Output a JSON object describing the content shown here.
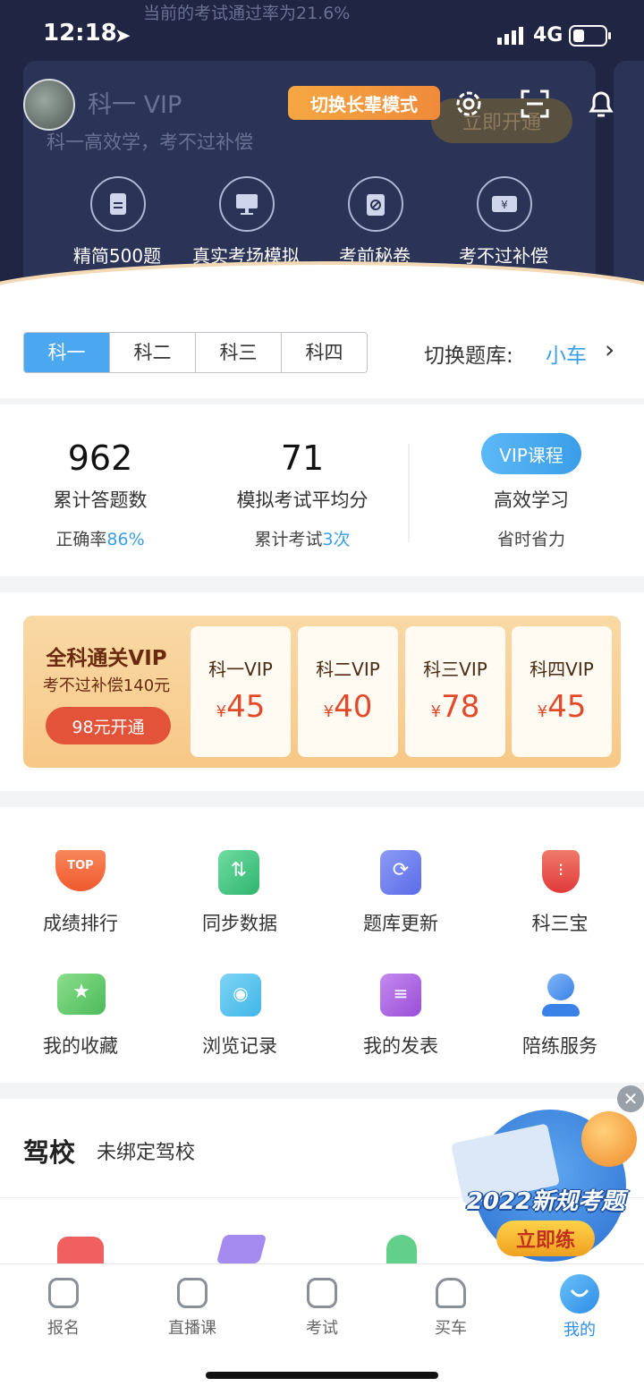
{
  "status_bar": {
    "time": "12:18",
    "network": "4G"
  },
  "hero": {
    "top_notice": "当前的考试通过率为21.6%",
    "title": "科一 VIP",
    "subtitle": "科一高效学，考不过补偿",
    "open_button": "立即开通",
    "elder_mode_button": "切换长辈模式",
    "features": [
      {
        "icon": "document-icon",
        "label": "精简500题"
      },
      {
        "icon": "monitor-icon",
        "label": "真实考场模拟"
      },
      {
        "icon": "clipboard-icon",
        "label": "考前秘卷"
      },
      {
        "icon": "ticket-icon",
        "label": "考不过补偿"
      }
    ]
  },
  "subjects": {
    "tabs": [
      "科一",
      "科二",
      "科三",
      "科四"
    ],
    "active": 0,
    "switch_label": "切换题库:",
    "switch_value": "小车"
  },
  "stats": {
    "answered": {
      "value": "962",
      "label": "累计答题数",
      "sub_label": "正确率",
      "sub_value": "86%"
    },
    "mock": {
      "value": "71",
      "label": "模拟考试平均分",
      "sub_label": "累计考试",
      "sub_value": "3次"
    },
    "vip_course": {
      "badge": "VIP课程",
      "line1": "高效学习",
      "line2": "省时省力"
    }
  },
  "vip_banner": {
    "title": "全科通关VIP",
    "subtitle": "考不过补偿140元",
    "button": "98元开通",
    "currency": "¥",
    "cards": [
      {
        "title": "科一VIP",
        "price": "45"
      },
      {
        "title": "科二VIP",
        "price": "40"
      },
      {
        "title": "科三VIP",
        "price": "78"
      },
      {
        "title": "科四VIP",
        "price": "45"
      }
    ]
  },
  "tools": [
    {
      "icon": "trophy-icon",
      "label": "成绩排行",
      "color": "#f26a3d"
    },
    {
      "icon": "sync-icon",
      "label": "同步数据",
      "color": "#3fc37f"
    },
    {
      "icon": "refresh-doc-icon",
      "label": "题库更新",
      "color": "#6b7cf0"
    },
    {
      "icon": "shield-icon",
      "label": "科三宝",
      "color": "#e84a4a"
    },
    {
      "icon": "star-folder-icon",
      "label": "我的收藏",
      "color": "#5bc868"
    },
    {
      "icon": "history-icon",
      "label": "浏览记录",
      "color": "#3fb6e8"
    },
    {
      "icon": "post-icon",
      "label": "我的发表",
      "color": "#a45cd8"
    },
    {
      "icon": "coach-icon",
      "label": "陪练服务",
      "color": "#3b82e8"
    }
  ],
  "driving_school": {
    "title": "驾校",
    "status": "未绑定驾校"
  },
  "promo": {
    "headline": "2022新规考题",
    "button": "立即练"
  },
  "bottom_nav": [
    {
      "icon": "signup-icon",
      "label": "报名"
    },
    {
      "icon": "live-icon",
      "label": "直播课"
    },
    {
      "icon": "exam-icon",
      "label": "考试"
    },
    {
      "icon": "car-icon",
      "label": "买车"
    },
    {
      "icon": "profile-icon",
      "label": "我的"
    }
  ],
  "active_nav": 4,
  "colors": {
    "accent": "#3a9ee8",
    "dark_header": "#1f2542",
    "price_red": "#e24a2a"
  }
}
